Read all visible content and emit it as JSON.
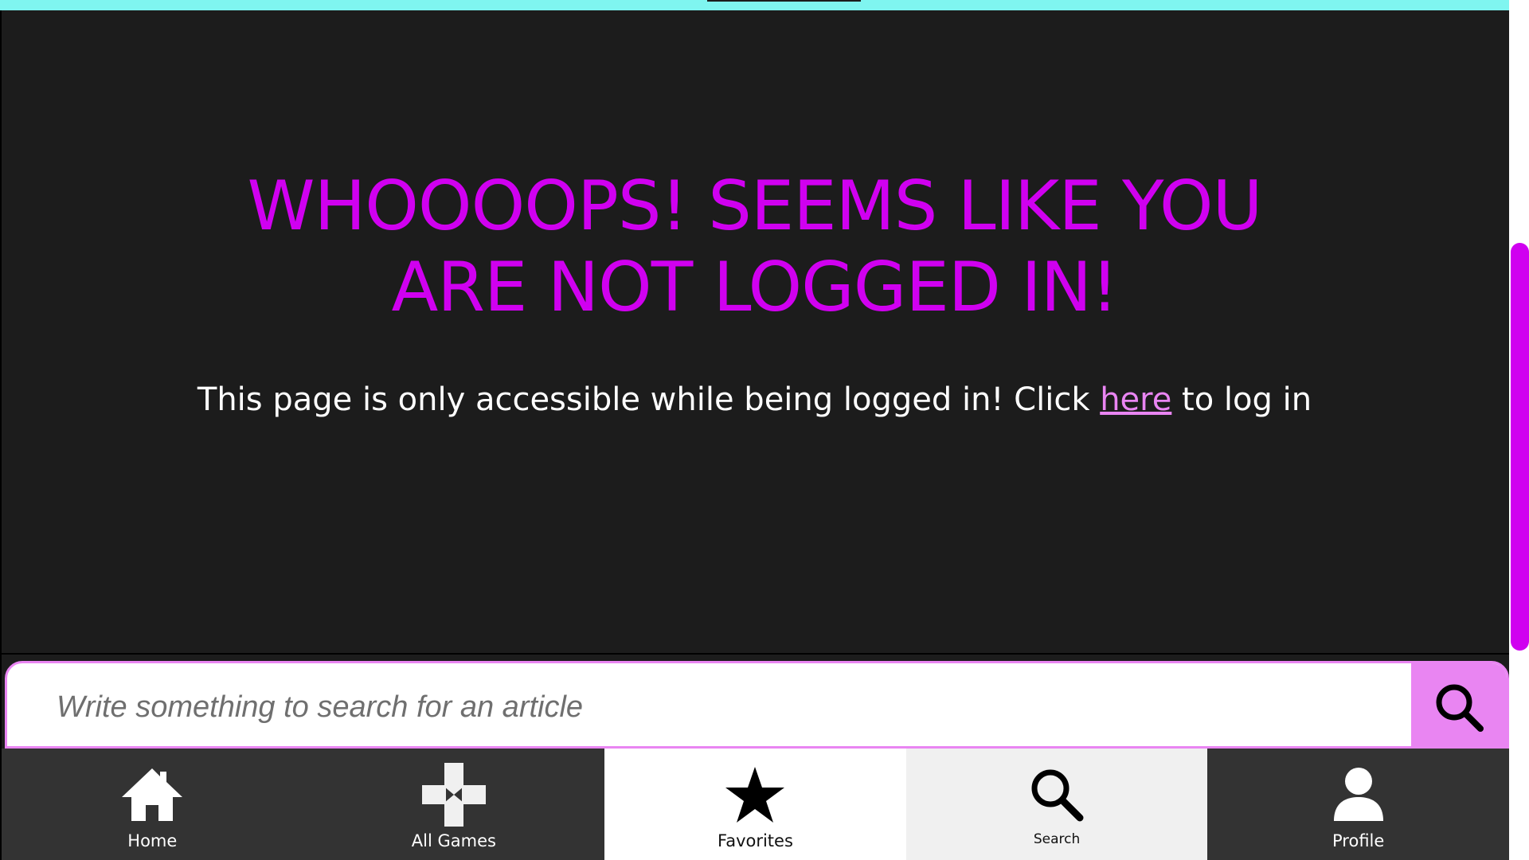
{
  "page": {
    "headline_line1": "WHOOOOPS! SEEMS LIKE YOU",
    "headline_line2": "ARE NOT LOGGED IN!",
    "message_before": "This page is only accessible while being logged in! Click ",
    "message_link": "here",
    "message_after": " to log in"
  },
  "search": {
    "placeholder": "Write something to search for an article"
  },
  "nav": {
    "items": [
      {
        "label": "Home",
        "icon": "home-icon"
      },
      {
        "label": "All Games",
        "icon": "gamepad-icon"
      },
      {
        "label": "Favorites",
        "icon": "star-icon"
      },
      {
        "label": "Search",
        "icon": "search-icon"
      },
      {
        "label": "Profile",
        "icon": "user-icon"
      }
    ]
  },
  "colors": {
    "headline": "#d000f0",
    "accent": "#e985f2",
    "top_bar": "#7ff5f0",
    "background": "#1c1c1c",
    "nav_dark": "#333333",
    "nav_light": "#f0f0f0"
  }
}
